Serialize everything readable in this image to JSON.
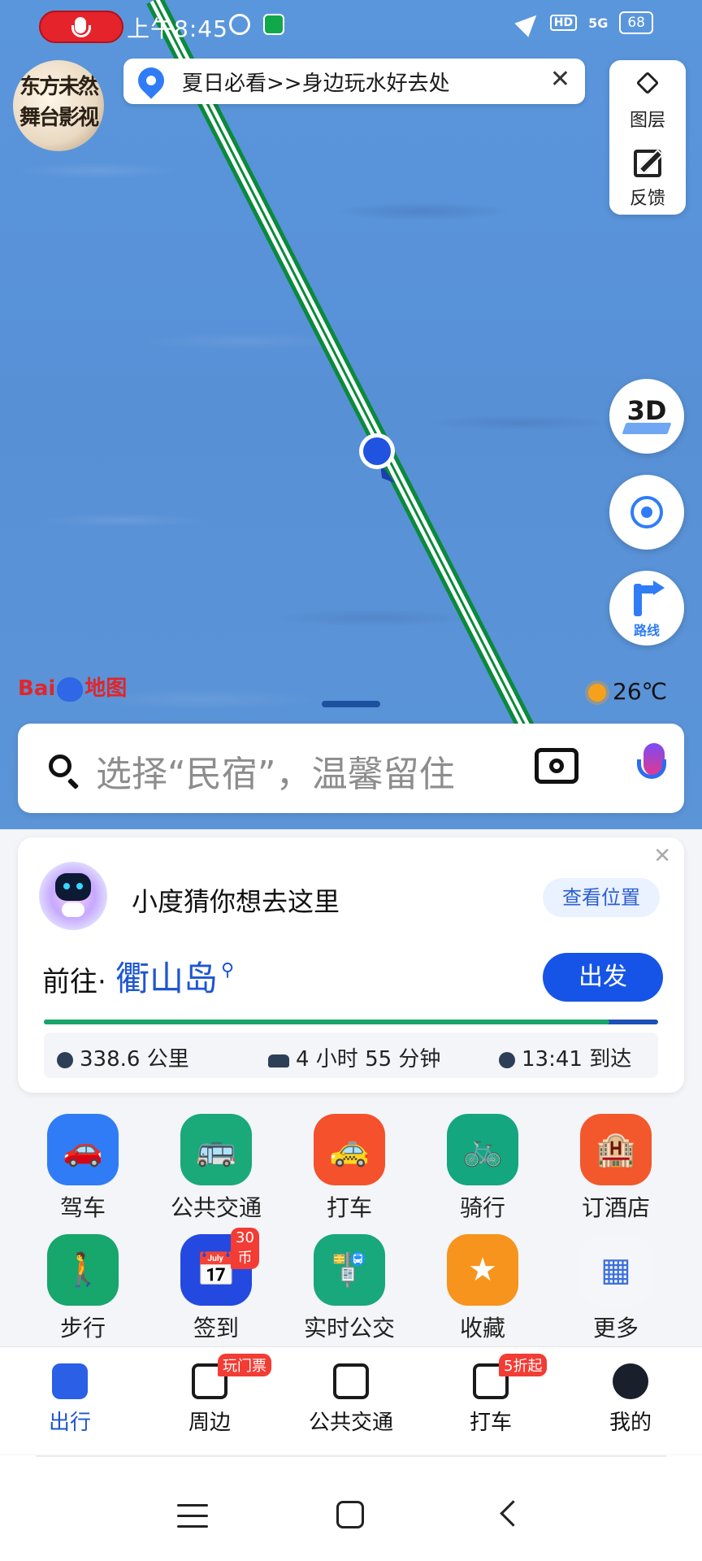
{
  "status_bar": {
    "time": "上午8:45",
    "net": "5G",
    "hd": "HD",
    "battery": "68"
  },
  "avatar_text": "东方未然 舞台影视",
  "banner": {
    "text": "夏日必看>>身边玩水好去处",
    "close": "✕"
  },
  "map_tools": {
    "layers": "图层",
    "feedback": "反馈",
    "btn_3d": "3D",
    "route": "路线"
  },
  "logo": {
    "left": "Bai",
    "right": "地图"
  },
  "weather": {
    "temp": "26℃"
  },
  "search": {
    "placeholder": "选择“民宿”，温馨留住"
  },
  "suggestion": {
    "title": "小度猜你想去这里",
    "view_btn": "查看位置",
    "goto": "前往·",
    "destination": "衢山岛",
    "go_btn": "出发",
    "progress": 0.92,
    "distance": "338.6 公里",
    "duration": "4 小时 55 分钟",
    "arrival": "13:41 到达",
    "close": "✕"
  },
  "grid": [
    {
      "label": "驾车",
      "icon": "car-icon",
      "color": "#2f7cf6",
      "glyph": "🚗"
    },
    {
      "label": "公共交通",
      "icon": "bus-icon",
      "color": "#1aa979",
      "glyph": "🚌"
    },
    {
      "label": "打车",
      "icon": "taxi-icon",
      "color": "#f4512c",
      "glyph": "🚕"
    },
    {
      "label": "骑行",
      "icon": "bike-icon",
      "color": "#13a67f",
      "glyph": "🚲"
    },
    {
      "label": "订酒店",
      "icon": "hotel-icon",
      "color": "#f2582c",
      "glyph": "🏨"
    },
    {
      "label": "步行",
      "icon": "walk-icon",
      "color": "#17a66b",
      "glyph": "🚶"
    },
    {
      "label": "签到",
      "icon": "checkin-icon",
      "color": "#2449e0",
      "glyph": "📅",
      "badge": "30币"
    },
    {
      "label": "实时公交",
      "icon": "realtime-bus-icon",
      "color": "#19a77c",
      "glyph": "🚏"
    },
    {
      "label": "收藏",
      "icon": "star-icon",
      "color": "#f7941d",
      "glyph": "★"
    },
    {
      "label": "更多",
      "icon": "more-icon",
      "color": "#f4f6fa",
      "glyph": "▦"
    }
  ],
  "tabs": [
    {
      "label": "出行",
      "icon": "travel-icon",
      "active": true
    },
    {
      "label": "周边",
      "icon": "nearby-icon",
      "badge": "玩门票"
    },
    {
      "label": "公共交通",
      "icon": "transit-icon"
    },
    {
      "label": "打车",
      "icon": "taxi-tab-icon",
      "badge": "5折起"
    },
    {
      "label": "我的",
      "icon": "profile-icon"
    }
  ]
}
